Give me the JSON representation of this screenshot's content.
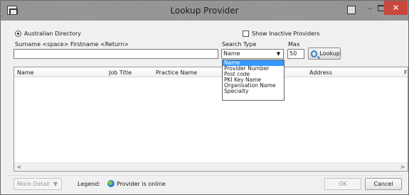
{
  "window": {
    "title": "Lookup Provider",
    "close_glyph": "✕",
    "minimize_glyph": "–"
  },
  "directory": {
    "label": "Australian Directory",
    "selected": true
  },
  "inactive": {
    "label": "Show Inactive Providers",
    "checked": false
  },
  "search": {
    "name_label": "Surname <space> Firstname <Return>",
    "name_value": "",
    "type_label": "Search Type",
    "type_value": "Name",
    "max_label": "Max",
    "max_value": "50",
    "lookup_label": "Lookup"
  },
  "search_type_options": [
    "Name",
    "Provider Number",
    "Post code",
    "PKI Key Name",
    "Organisation Name",
    "Specialty"
  ],
  "grid": {
    "columns": [
      "Name",
      "Job Title",
      "Practice Name",
      "Address",
      "F"
    ],
    "rows": []
  },
  "footer": {
    "more_detail_label": "More Detail",
    "legend_label": "Legend:",
    "legend_item": "Provider is online",
    "ok_label": "OK",
    "cancel_label": "Cancel"
  },
  "colors": {
    "titlebar": "#999999",
    "close_button": "#c9463d",
    "selection": "#3399ff",
    "lookup_icon": "#3b7dc4"
  },
  "icons": [
    "app-icon",
    "pin-icon",
    "minimize-icon",
    "maximize-icon",
    "close-icon",
    "radio-icon",
    "checkbox-icon",
    "search-icon",
    "chevron-down-icon",
    "globe-icon",
    "arrow-left-icon",
    "arrow-right-icon"
  ]
}
